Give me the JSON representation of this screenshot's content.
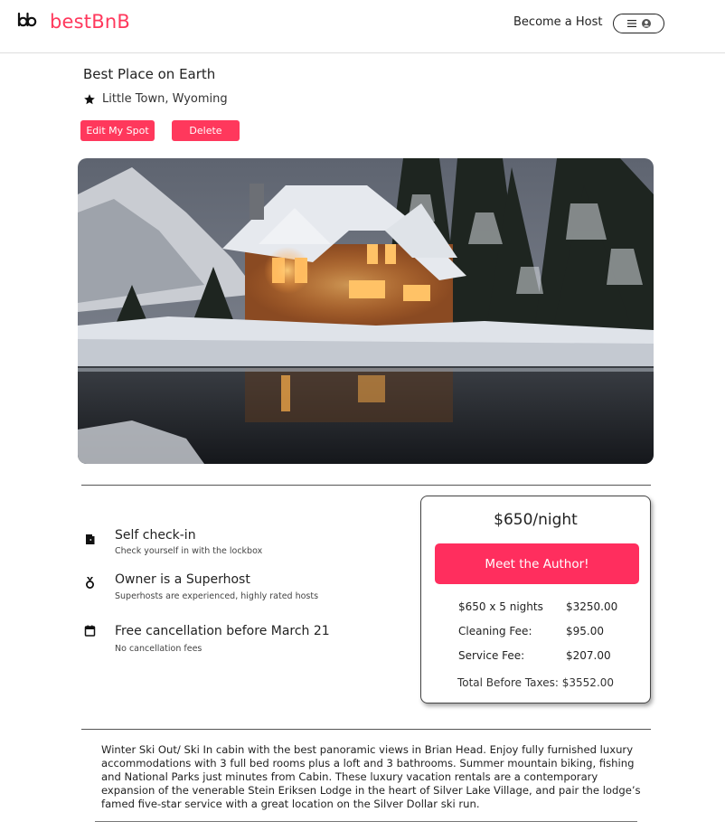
{
  "header": {
    "logo_text": "bestBnB",
    "become_host": "Become a Host",
    "menu_icon": "hamburger-menu-icon",
    "profile_icon": "user-circle-icon",
    "brand_color": "#ff385c"
  },
  "spot": {
    "title": "Best Place on Earth",
    "location": "Little Town, Wyoming",
    "edit_label": "Edit My Spot",
    "delete_label": "Delete"
  },
  "amenities": [
    {
      "icon": "door-icon",
      "title": "Self check-in",
      "subtitle": "Check yourself in with the lockbox"
    },
    {
      "icon": "medal-icon",
      "title": "Owner is a Superhost",
      "subtitle": "Superhosts are experienced, highly rated hosts"
    },
    {
      "icon": "calendar-icon",
      "title": "Free cancellation before March 21",
      "subtitle": "No cancellation fees"
    }
  ],
  "booking": {
    "price_per_night": "$650/night",
    "cta_label": "Meet the Author!",
    "fees": [
      {
        "label": "$650 x 5 nights",
        "value": "$3250.00"
      },
      {
        "label": "Cleaning Fee:",
        "value": "$95.00"
      },
      {
        "label": "Service Fee:",
        "value": "$207.00"
      }
    ],
    "total": "Total Before Taxes: $3552.00"
  },
  "description": "Winter Ski Out/ Ski In cabin with the best panoramic views in Brian Head. Enjoy fully furnished luxury accommodations with 3 full bed rooms plus a loft and 3 bathrooms. Summer mountain biking, fishing and National Parks just minutes from Cabin. These luxury vacation rentals are a contemporary expansion of the venerable Stein Eriksen Lodge in the heart of Silver Lake Village, and pair the lodge’s famed five-star service with a great location on the Silver Dollar ski run."
}
